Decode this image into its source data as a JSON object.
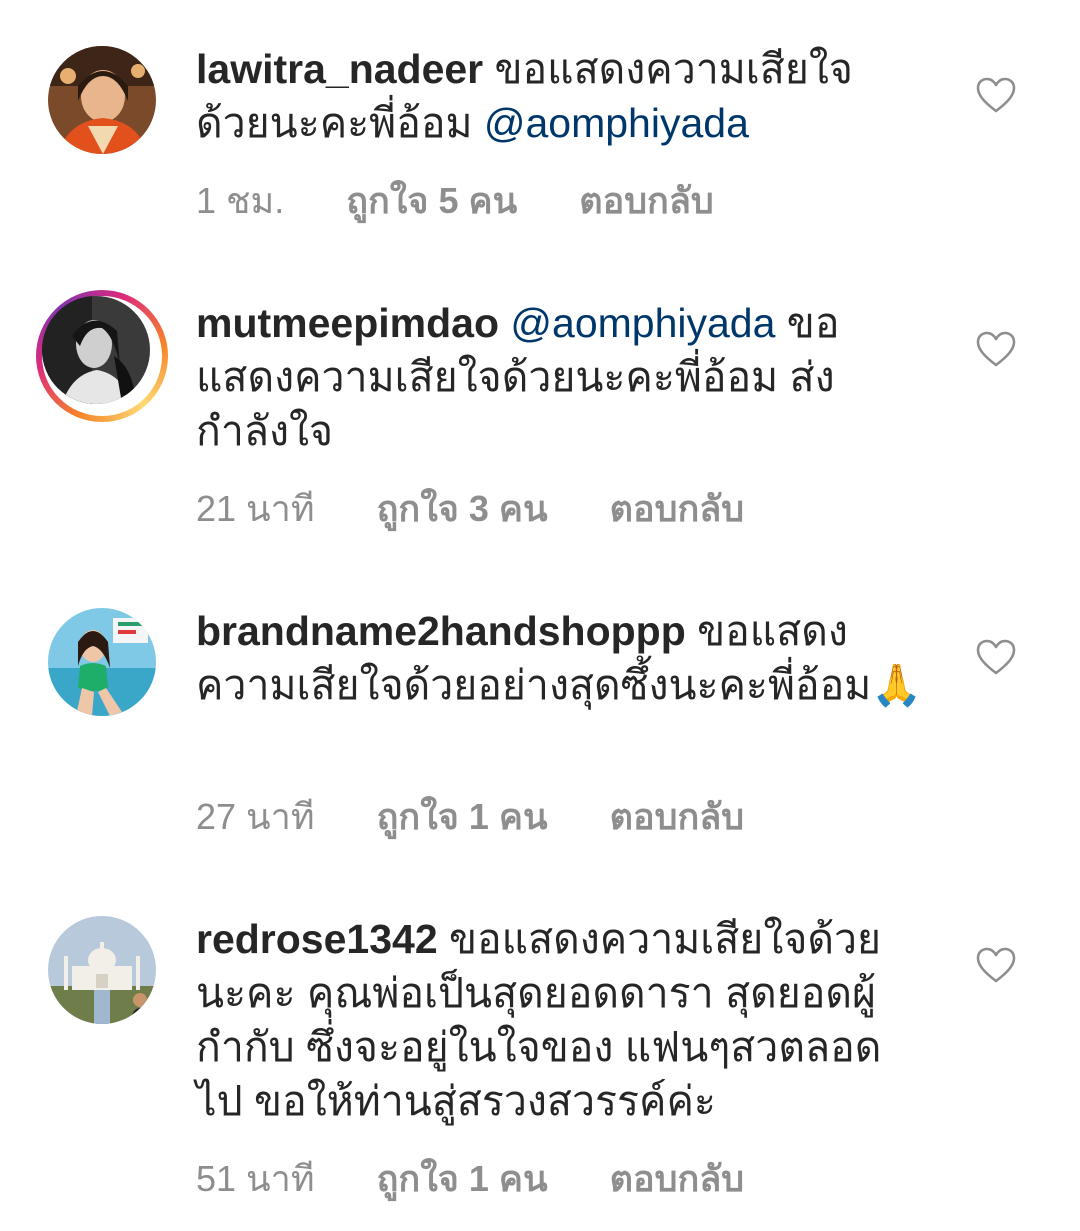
{
  "comments": [
    {
      "username": "lawitra_nadeer",
      "text_before": " ขอแสดงความเสียใจด้วยนะคะพี่อ้อม  ",
      "mention": "@aomphiyada",
      "text_after": "",
      "time": "1 ชม.",
      "likes": "ถูกใจ 5 คน",
      "reply": "ตอบกลับ"
    },
    {
      "username": "mutmeepimdao",
      "text_before": " ",
      "mention": "@aomphiyada",
      "text_after": " ขอแสดงความเสียใจด้วยนะคะพี่อ้อม ส่งกำลังใจ",
      "time": "21 นาที",
      "likes": "ถูกใจ 3 คน",
      "reply": "ตอบกลับ"
    },
    {
      "username": "brandname2handshoppp",
      "text_before": " ขอแสดงความเสียใจด้วยอย่างสุดซึ้งนะคะพี่อ้อม🙏",
      "mention": "",
      "text_after": "",
      "time": "27 นาที",
      "likes": "ถูกใจ 1 คน",
      "reply": "ตอบกลับ"
    },
    {
      "username": "redrose1342",
      "text_before": " ขอแสดงความเสียใจด้วยนะคะ  คุณพ่อเป็นสุดยอดดารา  สุดยอดผู้กำกับ  ซึ่งจะอยู่ในใจของ  แฟนๆสวตลอดไป  ขอให้ท่านสู่สรวงสวรรค์ค่ะ",
      "mention": "",
      "text_after": "",
      "time": "51 นาที",
      "likes": "ถูกใจ 1 คน",
      "reply": "ตอบกลับ"
    }
  ],
  "icons": {
    "like": "heart-outline-icon"
  },
  "colors": {
    "username": "#262626",
    "mention": "#00376b",
    "meta": "#8e8e8e",
    "story_ring_start": "#f58529",
    "story_ring_end": "#dd2a7b"
  }
}
